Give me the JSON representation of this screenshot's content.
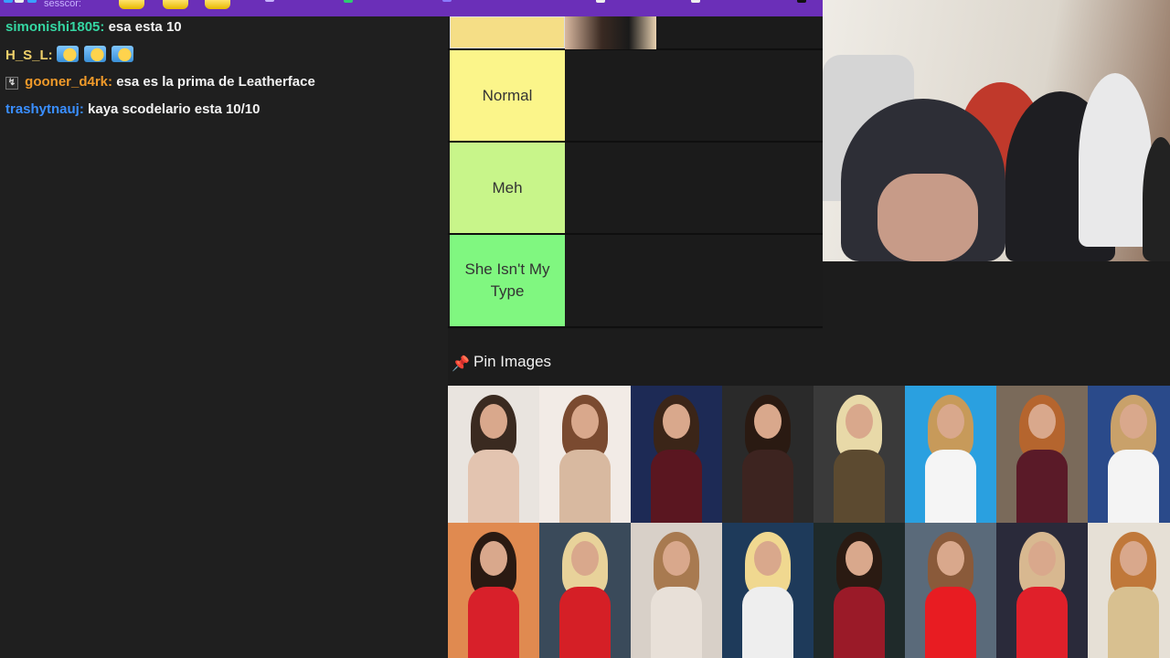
{
  "top_bar": {
    "username_fragment": "sesscor:",
    "accent": "#6b2fb8"
  },
  "chat": {
    "messages": [
      {
        "user": "simonishi1805:",
        "user_color": "#35d6a2",
        "text": "esa esta 10"
      },
      {
        "user": "H_S_L:",
        "user_color": "#f0d06a",
        "text": ""
      },
      {
        "user": "gooner_d4rk:",
        "user_color": "#f09a2a",
        "text": "esa es la prima de Leatherface"
      },
      {
        "user": "trashytnauj:",
        "user_color": "#3a8fff",
        "text": "kaya scodelario esta 10/10"
      }
    ]
  },
  "tiers": [
    {
      "label": "",
      "color": "#f5de86"
    },
    {
      "label": "Normal",
      "color": "#fbf58a"
    },
    {
      "label": "Meh",
      "color": "#c8f58a"
    },
    {
      "label": "She Isn't My Type",
      "color": "#80f780"
    }
  ],
  "pin_section": {
    "title": "Pin Images",
    "icon": "pin-icon"
  }
}
